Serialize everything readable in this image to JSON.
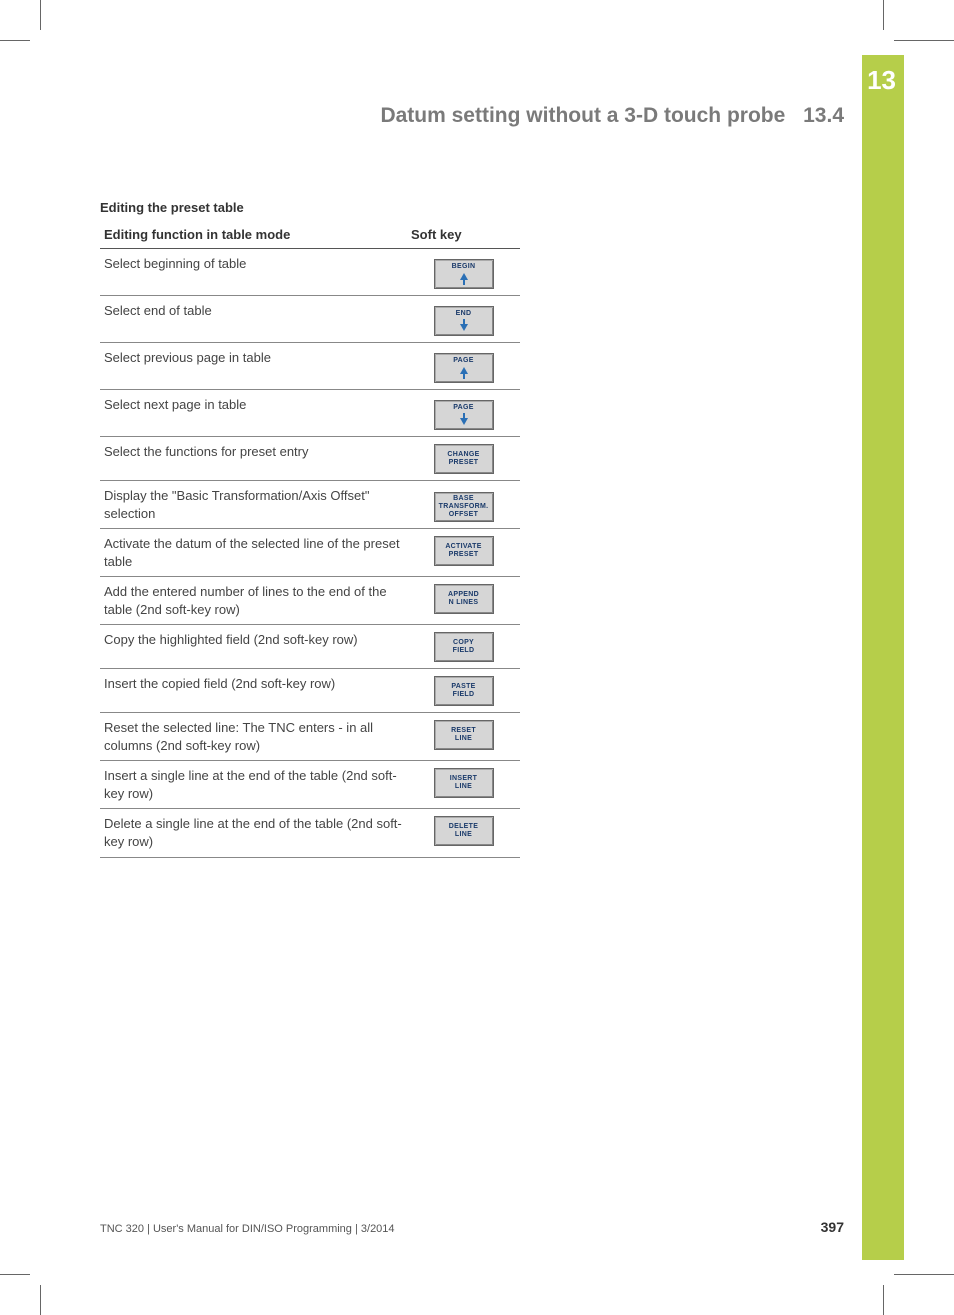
{
  "chapter_number": "13",
  "header": {
    "title": "Datum setting without a 3-D touch probe",
    "section_number": "13.4"
  },
  "section_title": "Editing the preset table",
  "columns": {
    "function": "Editing function in table mode",
    "softkey": "Soft key"
  },
  "rows": [
    {
      "func": "Select beginning of table",
      "key_label": "BEGIN",
      "key_icon": "up"
    },
    {
      "func": "Select end of table",
      "key_label": "END",
      "key_icon": "down"
    },
    {
      "func": "Select previous page in table",
      "key_label": "PAGE",
      "key_icon": "up"
    },
    {
      "func": "Select next page in table",
      "key_label": "PAGE",
      "key_icon": "down"
    },
    {
      "func": "Select the functions for preset entry",
      "key_label": "CHANGE\nPRESET",
      "key_icon": ""
    },
    {
      "func": "Display the \"Basic Transformation/Axis Offset\" selection",
      "key_label": "BASE\nTRANSFORM.\nOFFSET",
      "key_icon": ""
    },
    {
      "func": "Activate the datum of the selected line of the preset table",
      "key_label": "ACTIVATE\nPRESET",
      "key_icon": ""
    },
    {
      "func": "Add the entered number of lines to the end of the table (2nd soft-key row)",
      "key_label": "APPEND\nN LINES",
      "key_icon": ""
    },
    {
      "func": "Copy the highlighted field (2nd soft-key row)",
      "key_label": "COPY\nFIELD",
      "key_icon": ""
    },
    {
      "func": "Insert the copied field (2nd soft-key row)",
      "key_label": "PASTE\nFIELD",
      "key_icon": ""
    },
    {
      "func": "Reset the selected line: The TNC enters - in all columns (2nd soft-key row)",
      "key_label": "RESET\nLINE",
      "key_icon": ""
    },
    {
      "func": "Insert a single line at the end of the table (2nd soft-key row)",
      "key_label": "INSERT\nLINE",
      "key_icon": ""
    },
    {
      "func": "Delete a single line at the end of the table (2nd soft-key row)",
      "key_label": "DELETE\nLINE",
      "key_icon": ""
    }
  ],
  "footer": {
    "text": "TNC 320 | User's Manual for DIN/ISO Programming | 3/2014",
    "page": "397"
  }
}
